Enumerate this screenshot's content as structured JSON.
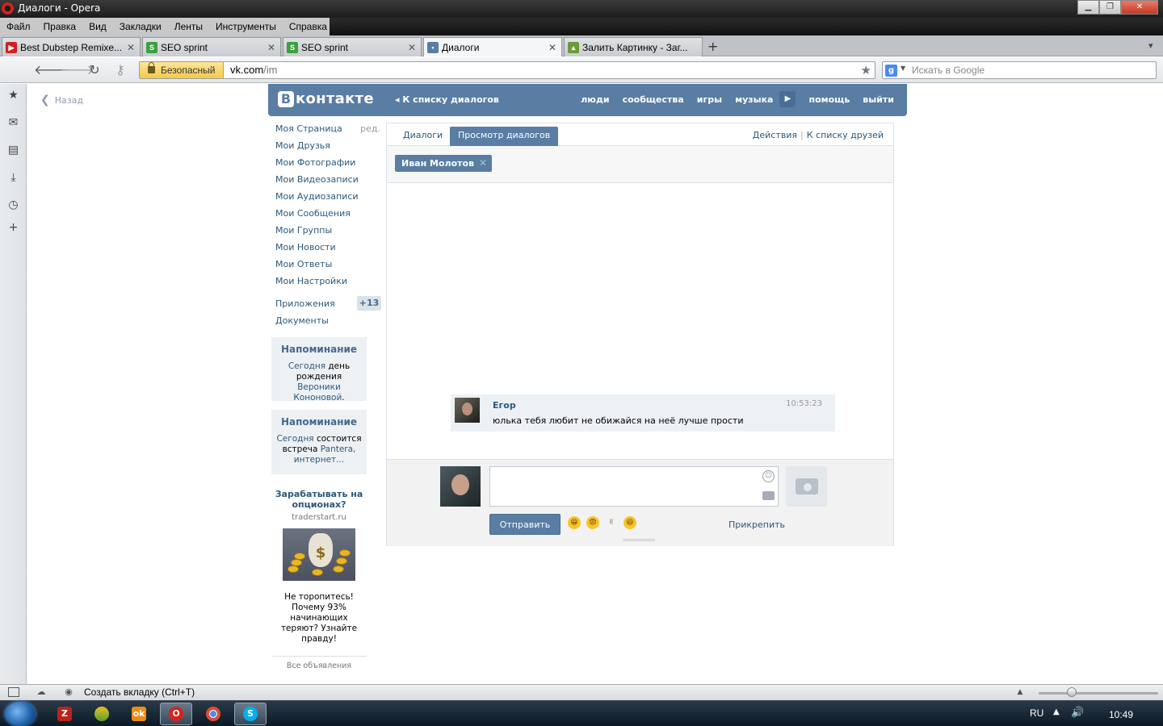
{
  "window": {
    "title": "Диалоги - Opera"
  },
  "menu": [
    "Файл",
    "Правка",
    "Вид",
    "Закладки",
    "Ленты",
    "Инструменты",
    "Справка"
  ],
  "tabs": [
    {
      "label": "Best Dubstep Remixe...",
      "icon": "youtube-icon"
    },
    {
      "label": "SEO sprint",
      "icon": "seosprint-icon"
    },
    {
      "label": "SEO sprint",
      "icon": "seosprint-icon"
    },
    {
      "label": "Диалоги",
      "icon": "vk-icon",
      "active": true
    },
    {
      "label": "Залить Картинку - Заг...",
      "icon": "image-host-icon"
    }
  ],
  "address": {
    "secure_label": "Безопасный",
    "host": "vk.com",
    "path": "/im"
  },
  "search": {
    "placeholder": "Искать в Google"
  },
  "page": {
    "back": "Назад"
  },
  "vk": {
    "logo_letter": "В",
    "logo_text": "контакте",
    "back_to_list": "К списку диалогов",
    "nav": [
      "люди",
      "сообщества",
      "игры",
      "музыка",
      "помощь",
      "выйти"
    ],
    "left_menu": [
      {
        "label": "Моя Страница",
        "edit": "ред."
      },
      {
        "label": "Мои Друзья"
      },
      {
        "label": "Мои Фотографии"
      },
      {
        "label": "Мои Видеозаписи"
      },
      {
        "label": "Мои Аудиозаписи"
      },
      {
        "label": "Мои Сообщения"
      },
      {
        "label": "Мои Группы"
      },
      {
        "label": "Мои Новости"
      },
      {
        "label": "Мои Ответы"
      },
      {
        "label": "Мои Настройки"
      }
    ],
    "apps": {
      "label": "Приложения",
      "badge": "+13"
    },
    "docs": "Документы",
    "reminder1": {
      "title": "Напоминание",
      "link1": "Сегодня",
      "t1": " день рождения ",
      "link2": "Вероники Кононовой",
      "t2": "."
    },
    "reminder2": {
      "title": "Напоминание",
      "link1": "Сегодня",
      "t1": " состоится встреча ",
      "link2": "Pantera, интернет..."
    },
    "ad": {
      "title": "Зарабатывать на опционах?",
      "domain": "traderstart.ru",
      "text": "Не торопитесь! Почему 93% начинающих теряют? Узнайте правду!",
      "all": "Все объявления"
    },
    "dialog": {
      "tab_dialogs": "Диалоги",
      "tab_view": "Просмотр диалогов",
      "actions": "Действия",
      "friends_list": "К списку друзей",
      "recipient": "Иван Молотов",
      "message": {
        "author": "Егор",
        "time": "10:53:23",
        "text": "юлька тебя любит не обижайся на неё лучше прости"
      },
      "send": "Отправить",
      "attach": "Прикрепить"
    }
  },
  "status": {
    "new_tab": "Создать вкладку (Ctrl+T)"
  },
  "taskbar": {
    "lang": "RU",
    "time": "10:49"
  }
}
